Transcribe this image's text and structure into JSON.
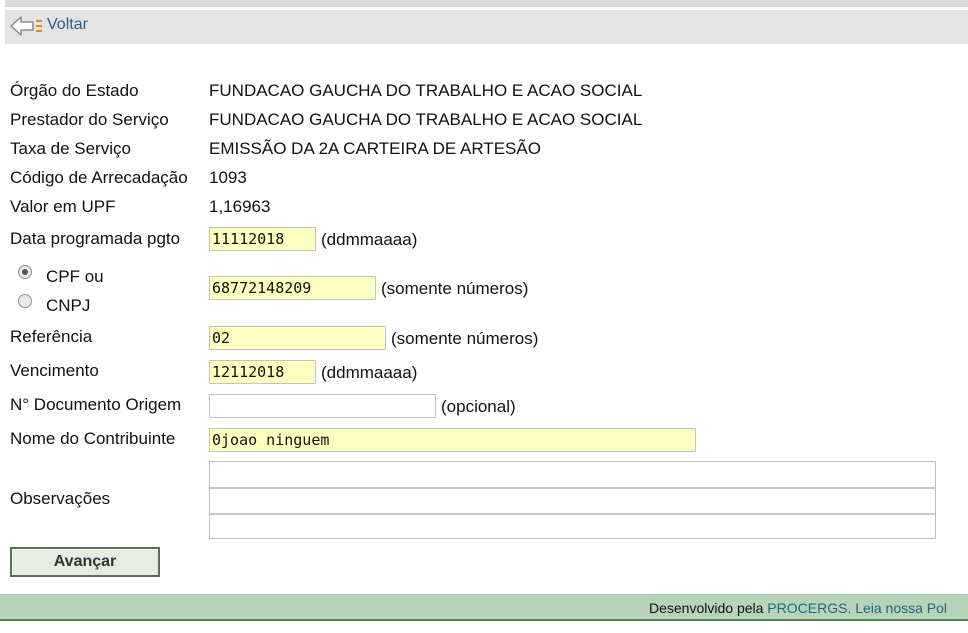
{
  "header": {
    "back_label": "Voltar"
  },
  "info": {
    "orgao_label": "Órgão do Estado",
    "orgao_value": "FUNDACAO GAUCHA DO TRABALHO E ACAO SOCIAL",
    "prestador_label": "Prestador do Serviço",
    "prestador_value": "FUNDACAO GAUCHA DO TRABALHO E ACAO SOCIAL",
    "taxa_label": "Taxa de Serviço",
    "taxa_value": "EMISSÃO DA 2A CARTEIRA DE ARTESÃO",
    "codigo_label": "Código de Arrecadação",
    "codigo_value": "1093",
    "upf_label": "Valor em UPF",
    "upf_value": "1,16963"
  },
  "form": {
    "data_pgto": {
      "label": "Data programada pgto",
      "value": "11112018",
      "hint": "(ddmmaaaa)"
    },
    "doc_type": {
      "cpf_label": "CPF ou",
      "cnpj_label": "CNPJ",
      "selected": "CPF"
    },
    "cpf_cnpj": {
      "value": "68772148209",
      "hint": "(somente números)"
    },
    "referencia": {
      "label": "Referência",
      "value": "02",
      "hint": "(somente números)"
    },
    "vencimento": {
      "label": "Vencimento",
      "value": "12112018",
      "hint": "(ddmmaaaa)"
    },
    "doc_origem": {
      "label": "N° Documento Origem",
      "value": "",
      "hint": "(opcional)"
    },
    "contribuinte": {
      "label": "Nome do Contribuinte",
      "value": "0joao ninguem"
    },
    "observacoes": {
      "label": "Observações",
      "value": ""
    },
    "submit_label": "Avançar"
  },
  "footer": {
    "prefix": "Desenvolvido pela ",
    "procergs_link": "PROCERGS.",
    "policy_link": " Leia nossa Pol"
  },
  "colors": {
    "field_yellow": "#ffffc0",
    "link_blue": "#2b5f8a",
    "footer_green": "#b7d4b6"
  }
}
